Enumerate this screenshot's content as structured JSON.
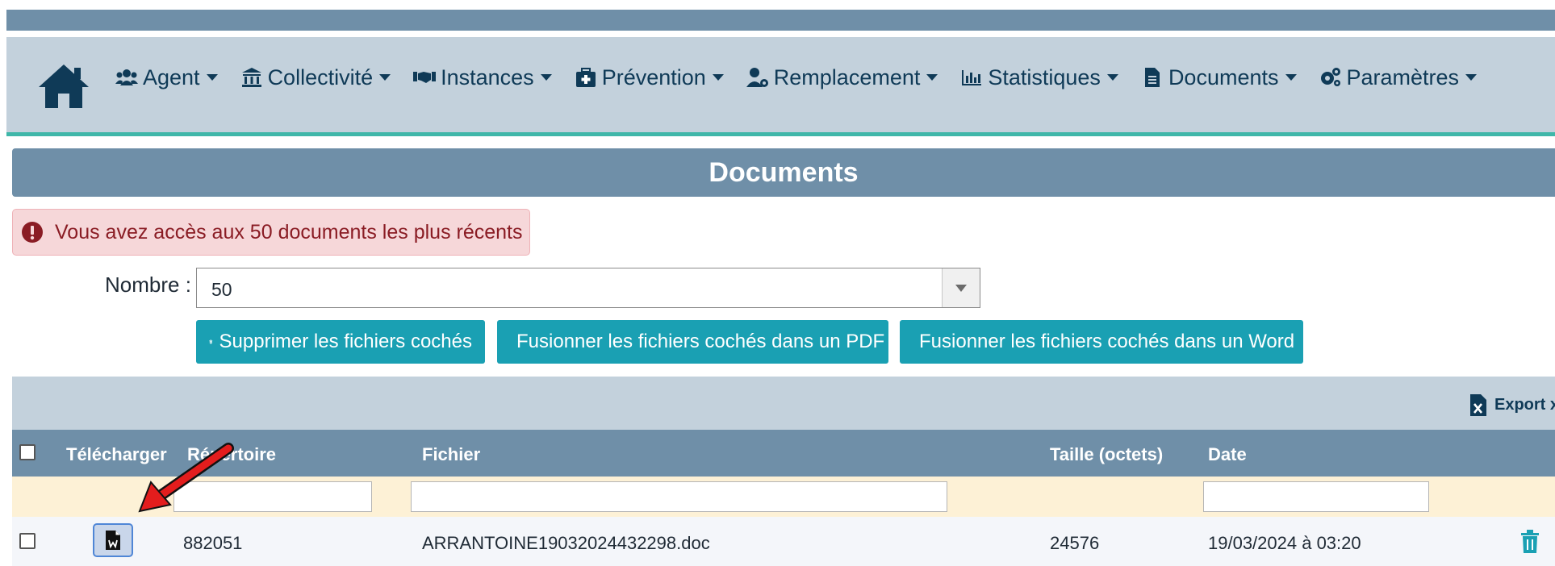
{
  "nav": {
    "items": [
      {
        "label": "Agent",
        "icon": "users-icon"
      },
      {
        "label": "Collectivité",
        "icon": "building-icon"
      },
      {
        "label": "Instances",
        "icon": "handshake-icon"
      },
      {
        "label": "Prévention",
        "icon": "medkit-icon"
      },
      {
        "label": "Remplacement",
        "icon": "user-gear-icon"
      },
      {
        "label": "Statistiques",
        "icon": "bar-chart-icon"
      },
      {
        "label": "Documents",
        "icon": "file-icon"
      },
      {
        "label": "Paramètres",
        "icon": "cogs-icon"
      }
    ]
  },
  "page": {
    "title": "Documents",
    "alert": "Vous avez accès aux 50 documents les plus récents",
    "nombre_label": "Nombre :",
    "nombre_value": "50"
  },
  "actions": {
    "delete": "Supprimer les fichiers cochés",
    "merge_pdf": "Fusionner les fichiers cochés dans un PDF",
    "merge_word": "Fusionner les fichiers cochés dans un Word",
    "export": "Export xls"
  },
  "table": {
    "headers": {
      "download": "Télécharger",
      "directory": "Répertoire",
      "file": "Fichier",
      "size": "Taille (octets)",
      "date": "Date"
    },
    "rows": [
      {
        "directory": "882051",
        "file": "ARRANTOINE19032024432298.doc",
        "size": "24576",
        "date": "19/03/2024 à 03:20"
      }
    ]
  },
  "colors": {
    "header_blue": "#6f8fa8",
    "nav_bg": "#c3d1dc",
    "accent_teal": "#1aa0b3",
    "alert_bg": "#f6d7d9",
    "filter_bg": "#fdf1d6"
  }
}
